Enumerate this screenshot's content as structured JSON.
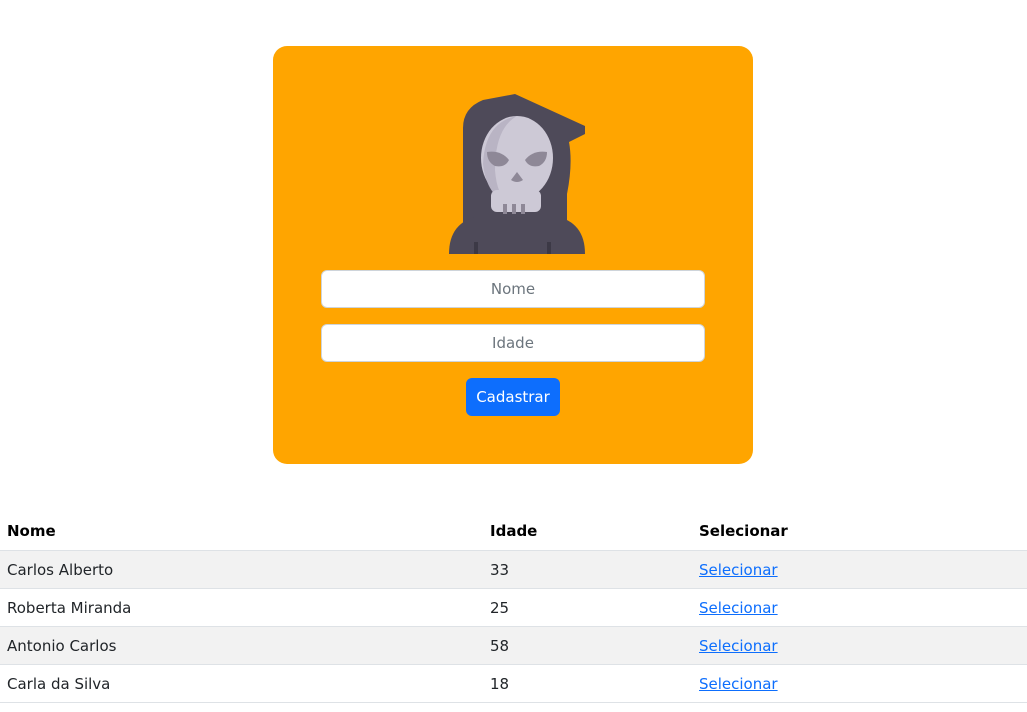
{
  "form": {
    "avatar_icon": "grim-reaper-icon",
    "nome_placeholder": "Nome",
    "idade_placeholder": "Idade",
    "submit_label": "Cadastrar",
    "card_color": "#ffa500",
    "button_color": "#0d6efd"
  },
  "table": {
    "headers": [
      "Nome",
      "Idade",
      "Selecionar"
    ],
    "rows": [
      {
        "nome": "Carlos Alberto",
        "idade": "33",
        "action": "Selecionar"
      },
      {
        "nome": "Roberta Miranda",
        "idade": "25",
        "action": "Selecionar"
      },
      {
        "nome": "Antonio Carlos",
        "idade": "58",
        "action": "Selecionar"
      },
      {
        "nome": "Carla da Silva",
        "idade": "18",
        "action": "Selecionar"
      }
    ]
  }
}
